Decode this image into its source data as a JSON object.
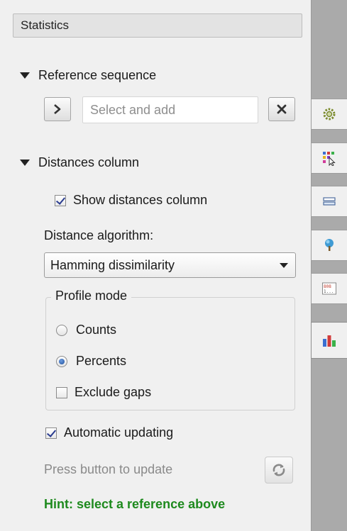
{
  "panel": {
    "title": "Statistics",
    "reference": {
      "heading": "Reference sequence",
      "placeholder": "Select and add"
    },
    "distances": {
      "heading": "Distances column",
      "show_label": "Show distances column",
      "show_checked": true,
      "algorithm_label": "Distance algorithm:",
      "algorithm_value": "Hamming dissimilarity",
      "profile": {
        "title": "Profile mode",
        "counts_label": "Counts",
        "percents_label": "Percents",
        "selected": "Percents",
        "exclude_gaps_label": "Exclude gaps",
        "exclude_gaps_checked": false
      },
      "auto_update_label": "Automatic updating",
      "auto_update_checked": true,
      "press_label": "Press button to update",
      "hint": "Hint: select a reference above"
    }
  },
  "side_tabs": [
    {
      "icon": "gear-icon"
    },
    {
      "icon": "color-grid-pointer-icon"
    },
    {
      "icon": "rows-icon"
    },
    {
      "icon": "tree-icon"
    },
    {
      "icon": "digits-grid-icon"
    },
    {
      "icon": "bar-chart-icon",
      "active": true
    }
  ],
  "colors": {
    "hint": "#1e8a1e",
    "panel_bg": "#f0f0f0",
    "side_bg": "#aaaaaa"
  }
}
